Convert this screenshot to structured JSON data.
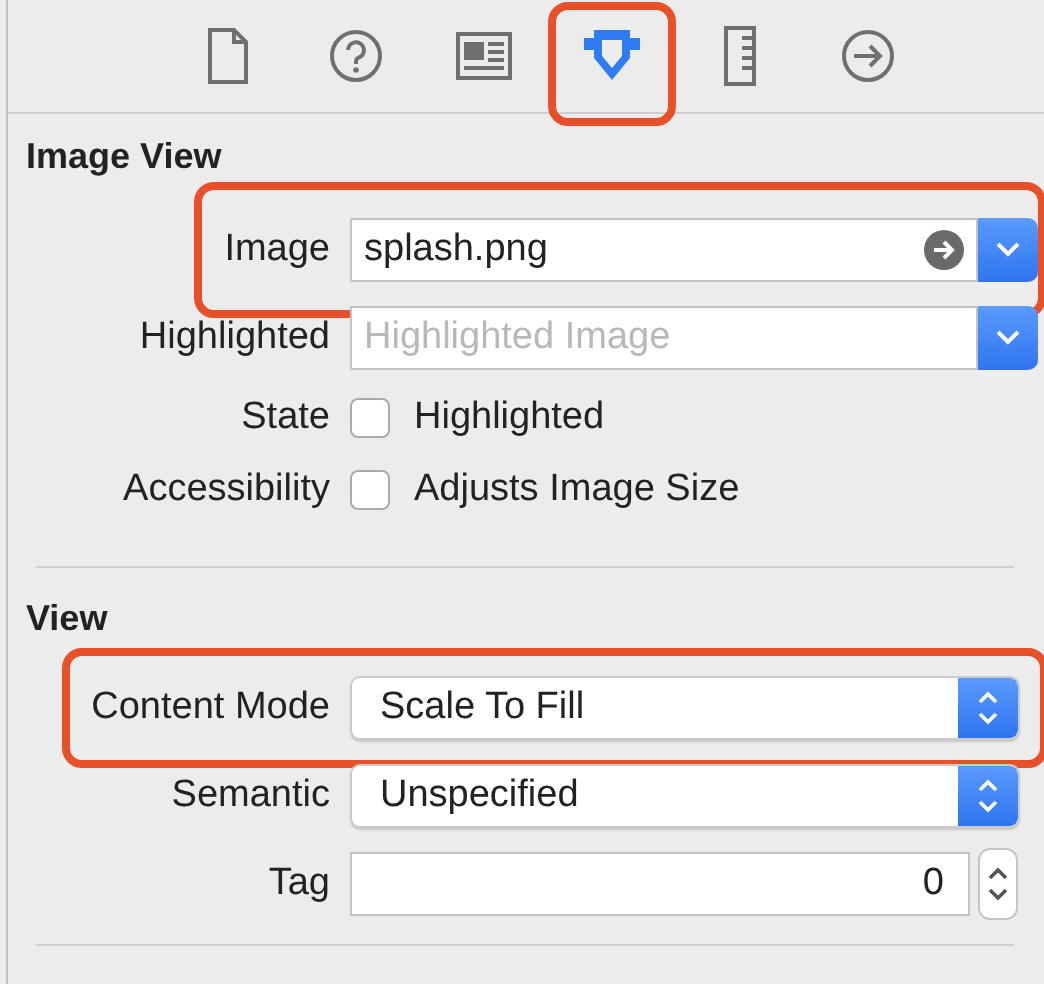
{
  "toolbar": {
    "tabs": [
      {
        "kind": "file",
        "selected": false,
        "annotated": false
      },
      {
        "kind": "help",
        "selected": false,
        "annotated": false
      },
      {
        "kind": "identity",
        "selected": false,
        "annotated": false
      },
      {
        "kind": "attributes",
        "selected": true,
        "annotated": true
      },
      {
        "kind": "size",
        "selected": false,
        "annotated": false
      },
      {
        "kind": "connections",
        "selected": false,
        "annotated": false
      }
    ]
  },
  "sections": [
    {
      "title": "Image View",
      "rows": [
        {
          "kind": "combo",
          "label": "Image",
          "value": "splash.png",
          "annotated": true
        },
        {
          "kind": "combo",
          "label": "Highlighted",
          "placeholder": "Highlighted Image",
          "annotated": false
        },
        {
          "kind": "checkbox",
          "label": "State",
          "text": "Highlighted",
          "checked": false,
          "annotated": false
        },
        {
          "kind": "checkbox",
          "label": "Accessibility",
          "text": "Adjusts Image Size",
          "checked": false,
          "annotated": false
        }
      ]
    },
    {
      "title": "View",
      "rows": [
        {
          "kind": "popup",
          "label": "Content Mode",
          "value": "Scale To Fill",
          "annotated": true
        },
        {
          "kind": "popup",
          "label": "Semantic",
          "value": "Unspecified",
          "annotated": false
        },
        {
          "kind": "stepper",
          "label": "Tag",
          "value": "0",
          "annotated": false
        }
      ]
    }
  ]
}
